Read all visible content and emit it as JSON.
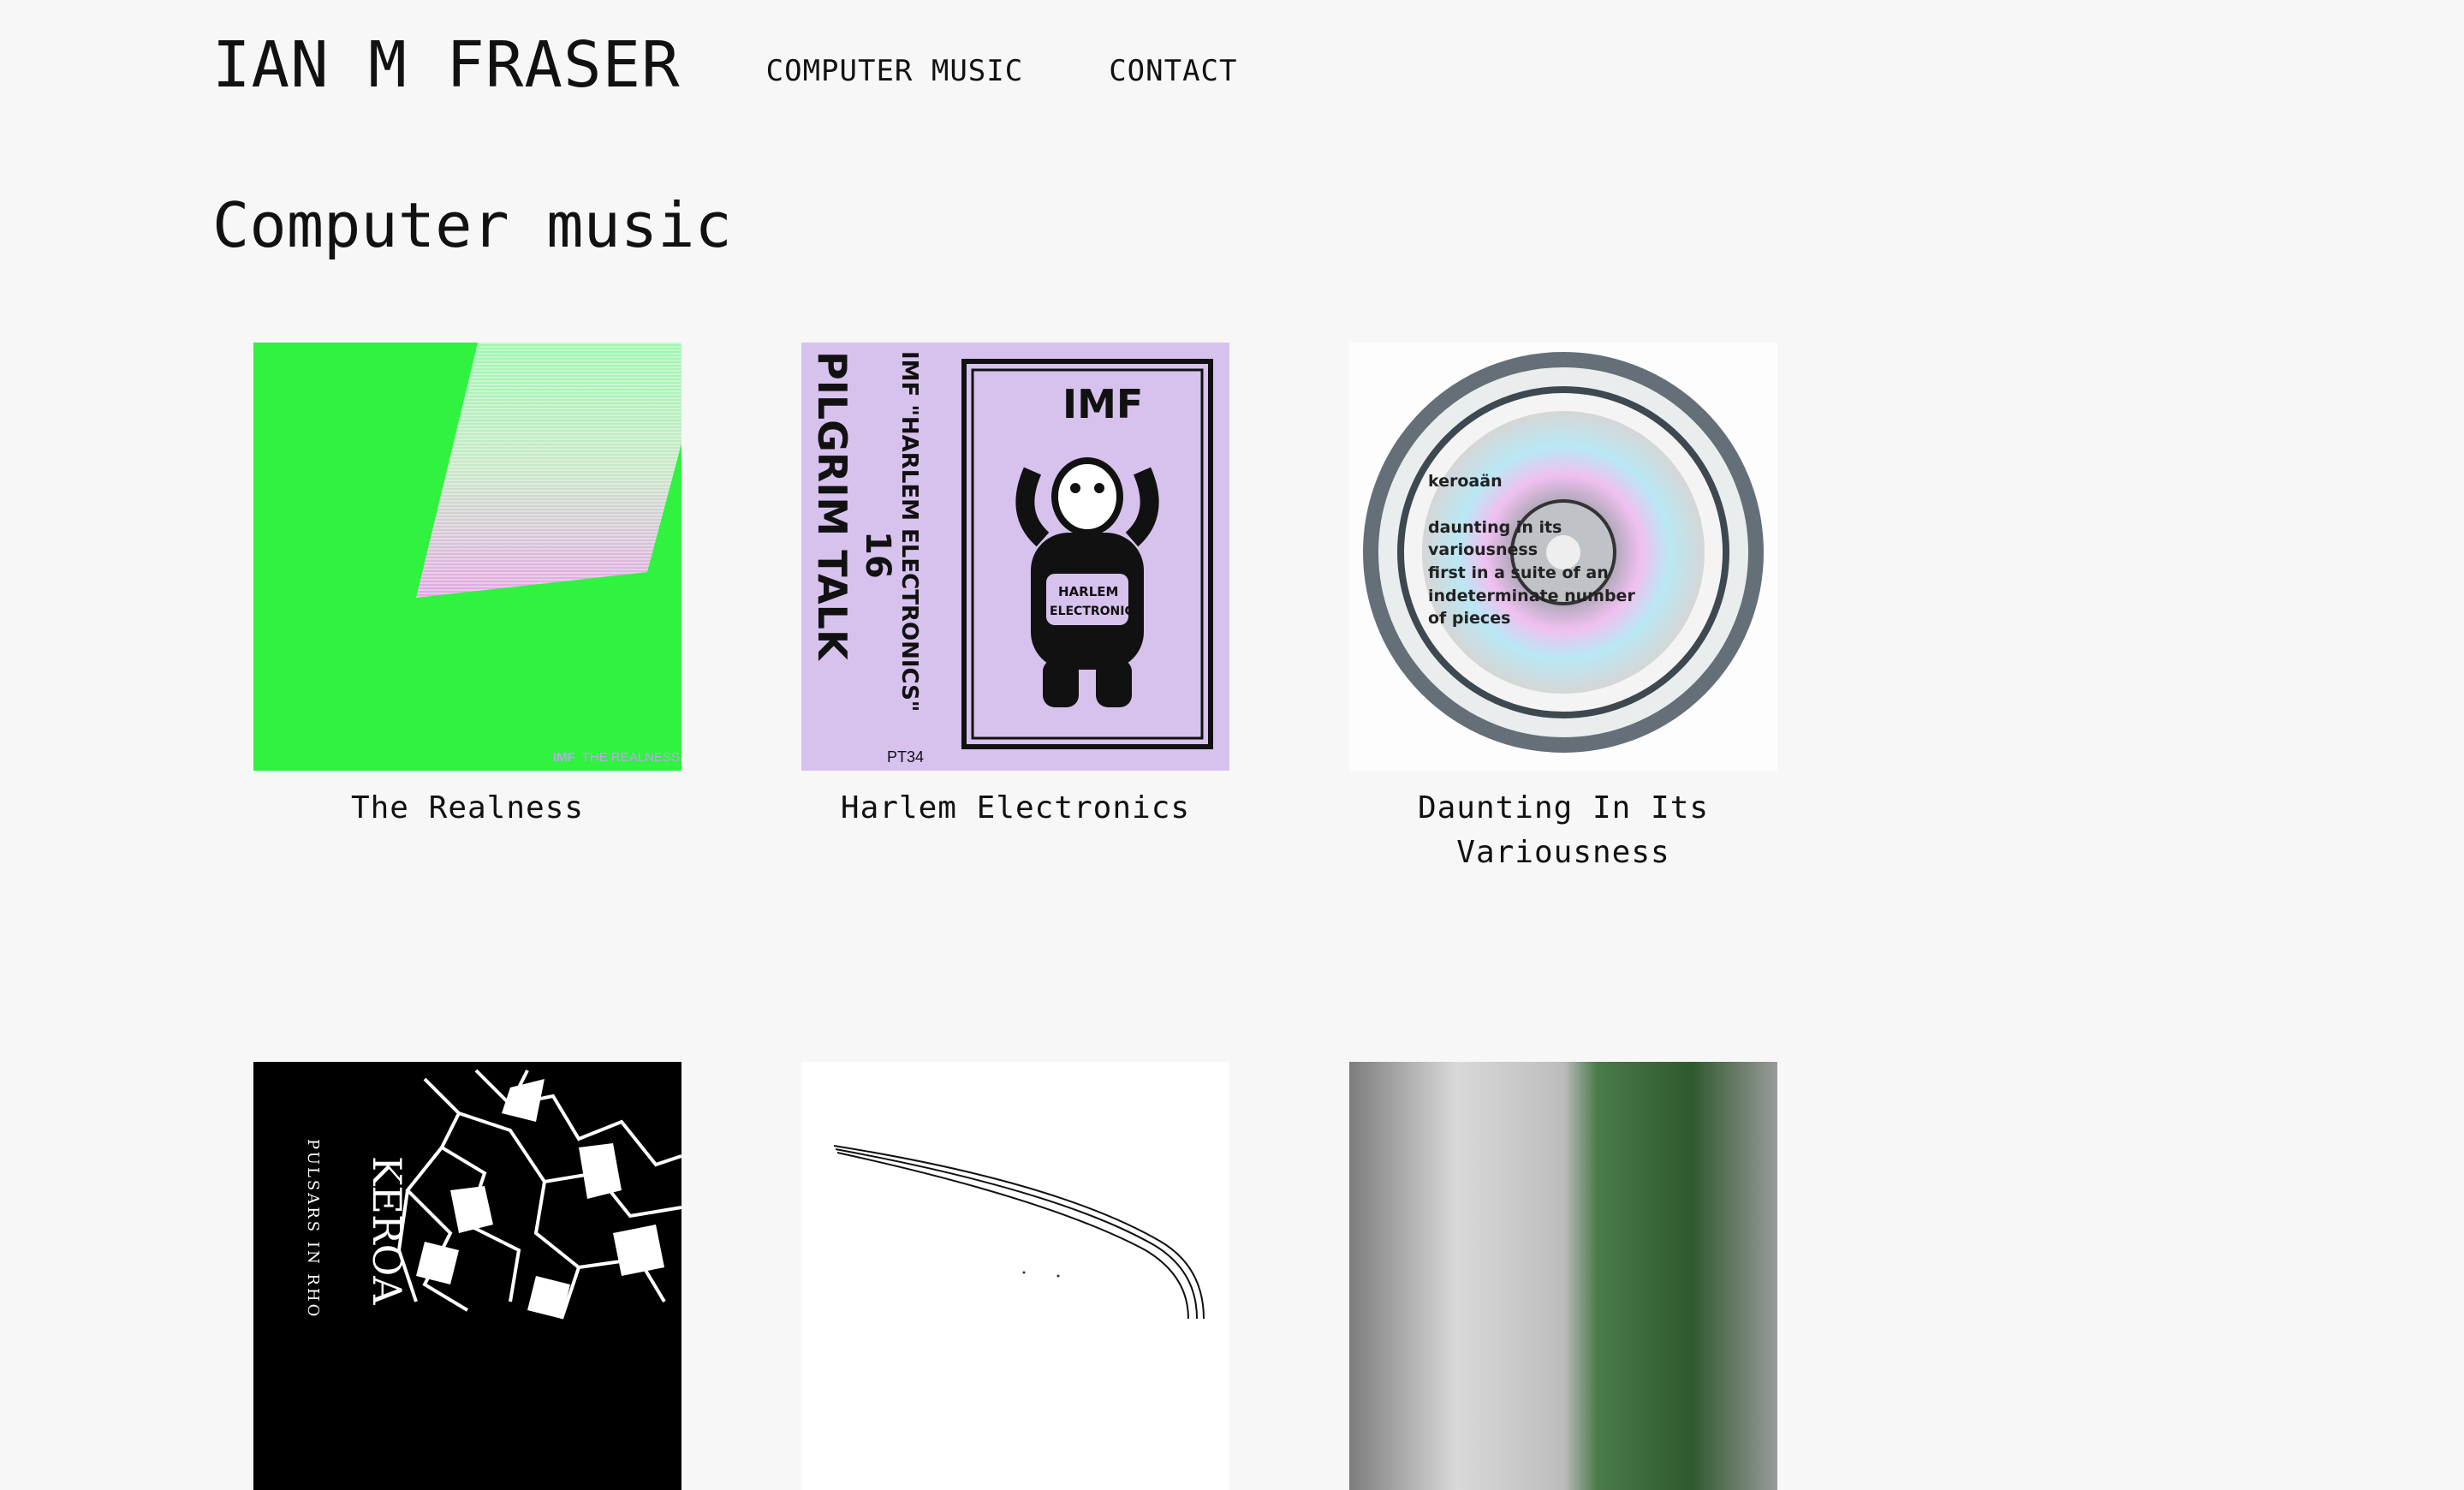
{
  "site": {
    "title": "IAN M FRASER"
  },
  "nav": {
    "items": [
      {
        "label": "COMPUTER MUSIC"
      },
      {
        "label": "CONTACT"
      }
    ]
  },
  "page": {
    "heading": "Computer music"
  },
  "releases": [
    {
      "title": "The Realness",
      "cover": {
        "icon": "green-gradient-cover",
        "corner_text_a": "IMF",
        "corner_text_b": "THE REALNESS"
      }
    },
    {
      "title": "Harlem Electronics",
      "cover": {
        "icon": "teletubby-cassette-cover",
        "imf": "IMF",
        "side": "PILGRIM TALK",
        "subtitle": "IMF \"HARLEM ELECTRONICS\"",
        "catalog": "PT34",
        "year": "16",
        "belly": "HARLEM",
        "belly2": "ELECTRONICS"
      }
    },
    {
      "title": "Daunting In Its Variousness",
      "cover": {
        "icon": "cd-in-case-cover",
        "lines": [
          "keroaän",
          "daunting in its",
          "variousness",
          "first in a suite of an",
          "indeterminate number",
          "of pieces"
        ]
      }
    },
    {
      "title": "",
      "cover": {
        "icon": "black-white-crackle-cover",
        "vertical_a": "KEROA",
        "vertical_b": "PULSARS IN RHO"
      }
    },
    {
      "title": "",
      "cover": {
        "icon": "white-curve-cover"
      }
    },
    {
      "title": "",
      "cover": {
        "icon": "grey-green-blur-cover"
      }
    }
  ]
}
